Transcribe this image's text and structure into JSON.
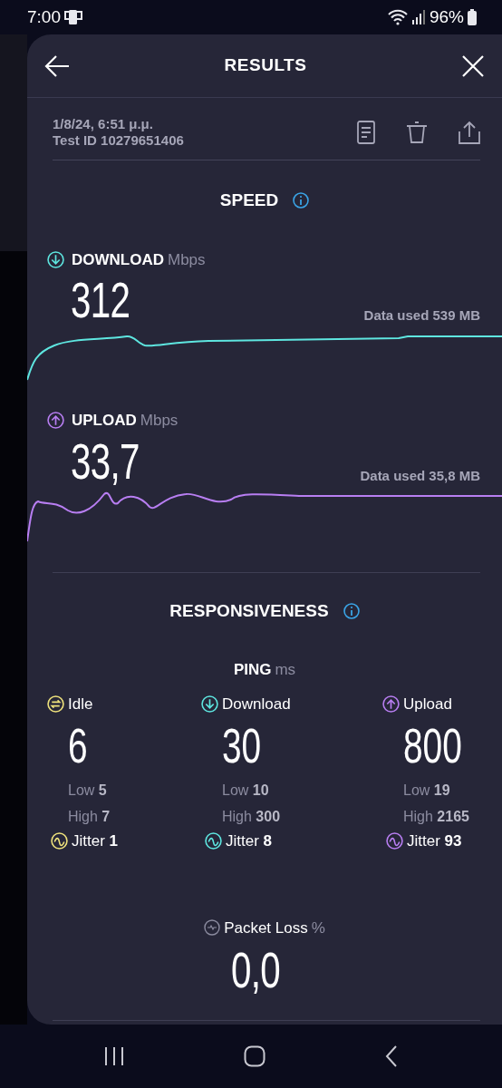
{
  "status_bar": {
    "time": "7:00",
    "battery": "96%"
  },
  "header": {
    "title": "RESULTS"
  },
  "test": {
    "date": "1/8/24, 6:51 μ.μ.",
    "test_id": "Test ID 10279651406"
  },
  "speed": {
    "title": "SPEED",
    "metrics": [
      {
        "kind": "download",
        "label": "DOWNLOAD",
        "unit": "Mbps",
        "value": "312",
        "data_used": "Data used 539 MB",
        "color": "#5ee6e0"
      },
      {
        "kind": "upload",
        "label": "UPLOAD",
        "unit": "Mbps",
        "value": "33,7",
        "data_used": "Data used 35,8 MB",
        "color": "#b87ef2"
      }
    ]
  },
  "responsiveness": {
    "title": "RESPONSIVENESS",
    "ping": {
      "label": "PING",
      "unit": "ms",
      "columns": [
        {
          "kind": "idle",
          "label": "Idle",
          "value": "6",
          "low": "Low **5**",
          "high": "High **7**",
          "jitter": "Jitter **1**",
          "color": "#efe27c"
        },
        {
          "kind": "download",
          "label": "Download",
          "value": "30",
          "low": "Low **10**",
          "high": "High **300**",
          "jitter": "Jitter **8**",
          "color": "#5ee6e0"
        },
        {
          "kind": "upload",
          "label": "Upload",
          "value": "800",
          "low": "Low **19**",
          "high": "High **2165**",
          "jitter": "Jitter **93**",
          "color": "#b87ef2"
        }
      ]
    }
  },
  "packet_loss": {
    "label": "Packet Loss",
    "unit": "%",
    "value": "0,0"
  }
}
